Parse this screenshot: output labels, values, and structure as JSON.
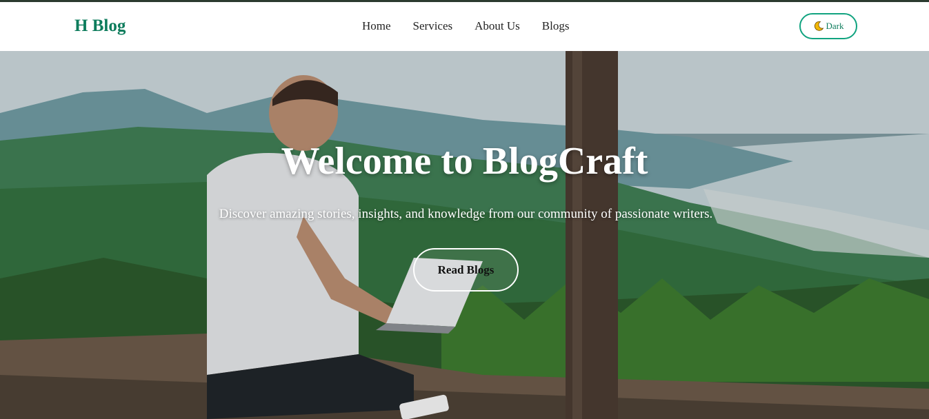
{
  "navbar": {
    "brand": "H Blog",
    "links": [
      "Home",
      "Services",
      "About Us",
      "Blogs"
    ],
    "theme_toggle": {
      "icon": "moon-icon",
      "label": "Dark"
    },
    "accent_color": "#0d7c5c",
    "toggle_border_color": "#10a37f"
  },
  "hero": {
    "title": "Welcome to BlogCraft",
    "subtitle": "Discover amazing stories, insights, and knowledge from our community of passionate writers.",
    "cta_label": "Read Blogs"
  }
}
